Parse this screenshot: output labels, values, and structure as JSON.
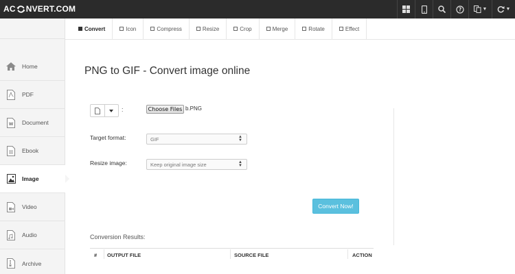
{
  "header": {
    "logo_left": "AC",
    "logo_right": "NVERT.COM"
  },
  "top_icons": [
    "grid-icon",
    "mobile-icon",
    "search-icon",
    "help-icon",
    "language-icon",
    "refresh-icon"
  ],
  "sidebar": {
    "items": [
      {
        "label": "Home",
        "icon": "home-icon"
      },
      {
        "label": "PDF",
        "icon": "pdf-icon"
      },
      {
        "label": "Document",
        "icon": "document-icon"
      },
      {
        "label": "Ebook",
        "icon": "ebook-icon"
      },
      {
        "label": "Image",
        "icon": "image-icon",
        "active": true
      },
      {
        "label": "Video",
        "icon": "video-icon"
      },
      {
        "label": "Audio",
        "icon": "audio-icon"
      },
      {
        "label": "Archive",
        "icon": "archive-icon"
      }
    ]
  },
  "tabs": [
    {
      "label": "Convert",
      "active": true
    },
    {
      "label": "Icon"
    },
    {
      "label": "Compress"
    },
    {
      "label": "Resize"
    },
    {
      "label": "Crop"
    },
    {
      "label": "Merge"
    },
    {
      "label": "Rotate"
    },
    {
      "label": "Effect"
    }
  ],
  "main": {
    "title": "PNG to GIF - Convert image online",
    "colon": ":",
    "choose_files_label": "Choose Files",
    "file_name": "b.PNG",
    "target_format_label": "Target format:",
    "target_format_value": "GIF",
    "resize_label": "Resize image:",
    "resize_value": "Keep original image size",
    "convert_button": "Convert Now!",
    "results_label": "Conversion Results:",
    "columns": [
      "#",
      "OUTPUT FILE",
      "SOURCE FILE",
      "ACTION"
    ]
  },
  "colors": {
    "topbar": "#2b2b2b",
    "accent": "#5bc0de",
    "sidebar_bg": "#f4f4f4"
  }
}
